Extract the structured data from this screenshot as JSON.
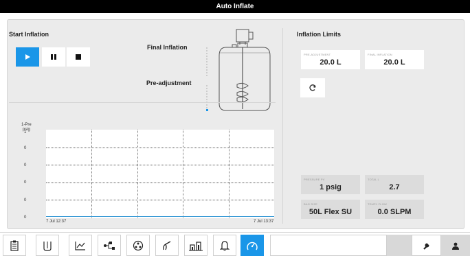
{
  "window": {
    "title": "Auto Inflate"
  },
  "start_inflation": {
    "title": "Start Inflation",
    "buttons": [
      {
        "name": "play",
        "icon": "play-icon",
        "active": true
      },
      {
        "name": "pause",
        "icon": "pause-icon",
        "active": false
      },
      {
        "name": "stop",
        "icon": "stop-icon",
        "active": false
      }
    ],
    "final_inflation_label": "Final Inflation",
    "pre_adjustment_label": "Pre-adjustment"
  },
  "chart_data": {
    "type": "line",
    "title": "",
    "ylabel": "1-Pre\npsig",
    "ytick_labels": [
      "1",
      "0",
      "0",
      "0",
      "0",
      "0"
    ],
    "xtick_labels": [
      "7 Jul 12:37",
      "7 Jul 13:37"
    ],
    "series": [
      {
        "values": [
          0,
          0
        ]
      }
    ],
    "grid": true
  },
  "inflation_limits": {
    "title": "Inflation Limits",
    "pre_adjustment": {
      "caption": "PRE-ADJUSTMENT",
      "value": "20.0 L"
    },
    "final_inflation": {
      "caption": "FINAL INFLATION",
      "value": "20.0 L"
    },
    "refresh_icon": "refresh-icon"
  },
  "readouts": [
    {
      "caption": "PRESSURE PV",
      "value": "1 psig"
    },
    {
      "caption": "TOTAL L",
      "value": "2.7"
    },
    {
      "caption": "BAG SIZE",
      "value": "50L Flex SU"
    },
    {
      "caption": "TEMP1 FLOW",
      "value": "0.0 SLPM"
    }
  ],
  "nav": {
    "items": [
      {
        "name": "clipboard",
        "icon": "clipboard-icon"
      },
      {
        "name": "vessel",
        "icon": "vessel-icon"
      },
      {
        "name": "trend",
        "icon": "trend-chart-icon"
      },
      {
        "name": "flow",
        "icon": "flow-diagram-icon"
      },
      {
        "name": "agitator",
        "icon": "agitator-icon"
      },
      {
        "name": "probe",
        "icon": "probe-icon"
      },
      {
        "name": "pumps",
        "icon": "pumps-icon"
      },
      {
        "name": "alarm",
        "icon": "bell-icon"
      },
      {
        "name": "gauge",
        "icon": "gauge-icon",
        "active": true
      }
    ],
    "settings_icon": "wrench-icon",
    "user_icon": "user-icon"
  },
  "colors": {
    "accent": "#1a96e8",
    "panel": "#ebebeb",
    "titlebar": "#000000"
  }
}
